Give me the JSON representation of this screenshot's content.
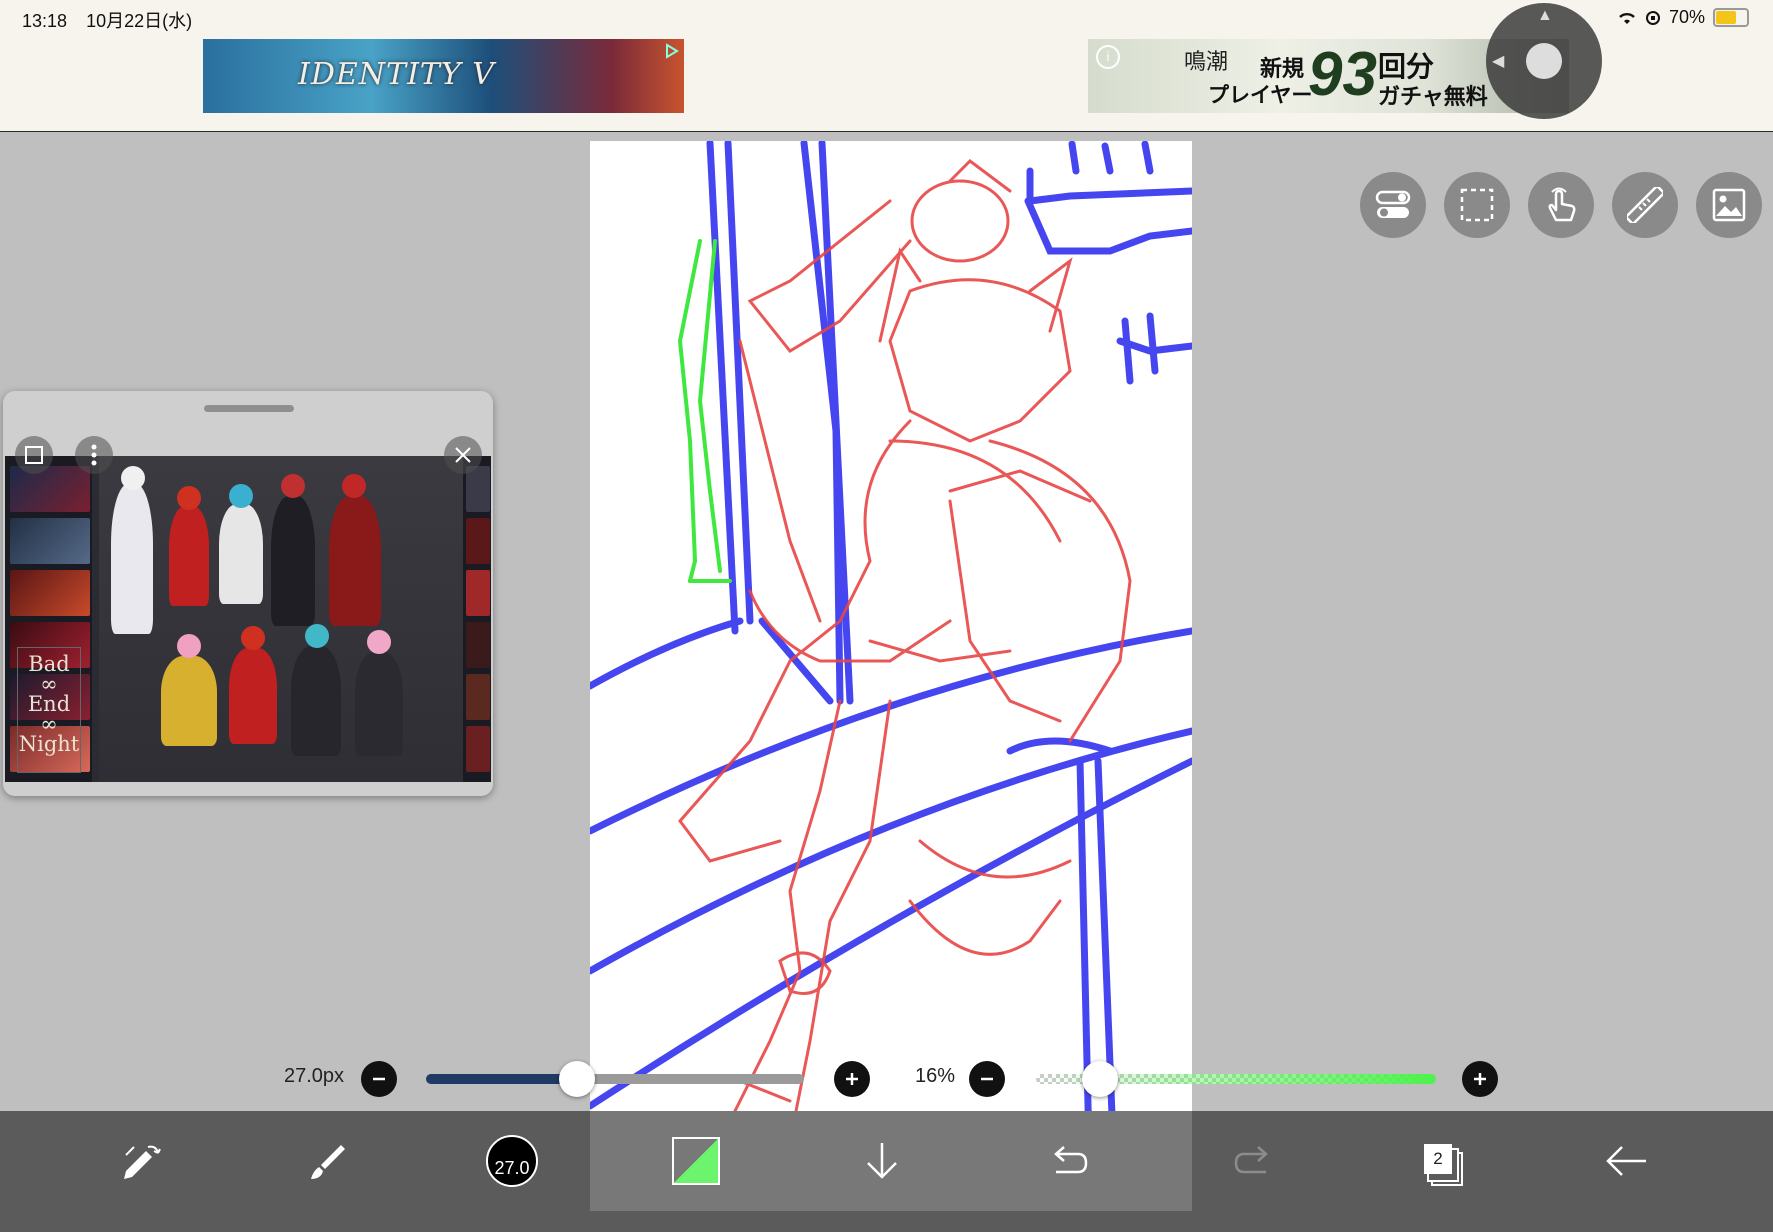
{
  "status_bar": {
    "time": "13:18",
    "date": "10月22日(水)",
    "battery": "70%",
    "battery_level": 0.7
  },
  "ads": {
    "left": {
      "title": "IDENTITY V"
    },
    "right": {
      "line1": "鳴潮",
      "line2": "新規",
      "line3": "プレイヤー",
      "line4": "93",
      "line5": "回分",
      "line6": "ガチャ無料"
    }
  },
  "reference_window": {
    "caption": "Bad ∞ End ∞ Night"
  },
  "brush_size": {
    "label": "27.0px",
    "value": 27.0,
    "level": 0.4
  },
  "opacity": {
    "label": "16%",
    "level": 0.16
  },
  "bottom_toolbar": {
    "brush_size_indicator": "27.0",
    "layer_count": "2"
  },
  "colors": {
    "accent_green": "#4cf24c",
    "sketch_red": "#e84545",
    "guide_blue": "#3b3bf0",
    "slider_navy": "#1f3b63"
  }
}
